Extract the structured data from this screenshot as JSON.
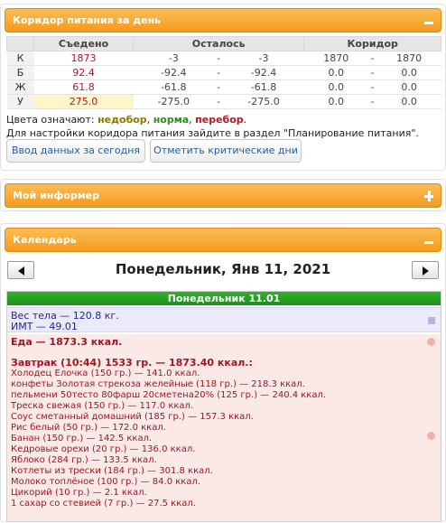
{
  "corridor_panel": {
    "title": "Коридор питания за день",
    "headers": {
      "eaten": "Съедено",
      "remaining": "Осталось",
      "corridor": "Коридор"
    },
    "rows": [
      {
        "label": "К",
        "eaten": "1873",
        "rem_from": "-3",
        "rem_sep": "-",
        "rem_to": "-3",
        "cor_from": "1870",
        "cor_sep": "-",
        "cor_to": "1870"
      },
      {
        "label": "Б",
        "eaten": "92.4",
        "rem_from": "-92.4",
        "rem_sep": "-",
        "rem_to": "-92.4",
        "cor_from": "0.0",
        "cor_sep": "-",
        "cor_to": "0.0"
      },
      {
        "label": "Ж",
        "eaten": "61.8",
        "rem_from": "-61.8",
        "rem_sep": "-",
        "rem_to": "-61.8",
        "cor_from": "0.0",
        "cor_sep": "-",
        "cor_to": "0.0"
      },
      {
        "label": "У",
        "eaten": "275.0",
        "rem_from": "-275.0",
        "rem_sep": "-",
        "rem_to": "-275.0",
        "cor_from": "0.0",
        "cor_sep": "-",
        "cor_to": "0.0"
      }
    ],
    "legend_prefix": "Цвета означают:",
    "legend_under": "недобор",
    "legend_norm": "норма",
    "legend_over": "перебор",
    "legend_end": ".",
    "hint": "Для настройки коридора питания зайдите в раздел \"Планирование питания\".",
    "button_enter": "Ввод данных за сегодня",
    "button_critical": "Отметить критические дни"
  },
  "informer_panel": {
    "title": "Мой информер"
  },
  "calendar_panel": {
    "title": "Календарь",
    "date": "Понедельник, Янв 11, 2021",
    "day_header": "Понедельник 11.01",
    "weight": "Вес тела — 120.8 кг.",
    "bmi": "ИМТ — 49.01",
    "food_total": "Еда — 1873.3 ккал.",
    "meal_title": "Завтрак (10:44) 1533 гр. — 1873.40 ккал.:",
    "items": [
      "Холодец Елочка (150 гр.) — 141.0 ккал.",
      "конфеты Золотая стрекоза желейные (118 гр.) — 218.3 ккал.",
      "пельмени 50тесто 80фарш 20сметена20% (125 гр.) — 240.4 ккал.",
      "Треска свежая (150 гр.) — 117.0 ккал.",
      "Соус сметанный домашний (185 гр.) — 157.3 ккал.",
      "Рис белый (50 гр.) — 172.0 ккал.",
      "Банан (150 гр.) — 142.5 ккал.",
      "Кедровые орехи (20 гр.) — 136.0 ккал.",
      "Яблоко (284 гр.) — 133.5 ккал.",
      "Котлеты из трески (184 гр.) — 301.8 ккал.",
      "Молоко топлёное (100 гр.) — 84.0 ккал.",
      "Цикорий (10 гр.) — 2.1 ккал.",
      "1 сахар со стевией (7 гр.) — 27.5 ккал."
    ]
  }
}
